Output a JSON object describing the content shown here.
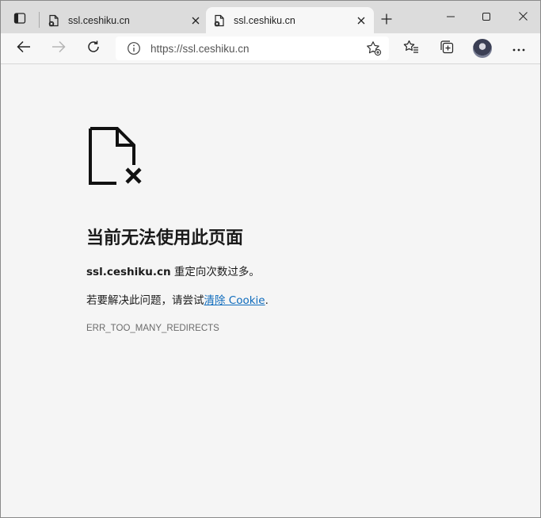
{
  "tabs": [
    {
      "title": "ssl.ceshiku.cn",
      "active": false
    },
    {
      "title": "ssl.ceshiku.cn",
      "active": true
    }
  ],
  "addressbar": {
    "url": "https://ssl.ceshiku.cn"
  },
  "error": {
    "title": "当前无法使用此页面",
    "host": "ssl.ceshiku.cn",
    "message": " 重定向次数过多。",
    "hint_prefix": "若要解决此问题，请尝试",
    "hint_link": "清除 Cookie",
    "hint_suffix": ".",
    "code": "ERR_TOO_MANY_REDIRECTS"
  },
  "icons": {
    "tab_actions": "tab-actions-icon",
    "page_error": "broken-page-icon",
    "back": "back-arrow-icon",
    "forward": "forward-arrow-icon",
    "refresh": "refresh-icon",
    "info": "info-icon",
    "add_favorite": "add-favorite-icon",
    "favorites": "favorites-icon",
    "collections": "collections-icon",
    "more": "more-icon",
    "new_tab": "plus-icon",
    "close_tab": "close-icon"
  },
  "colors": {
    "link": "#0f6cbd",
    "tabstrip": "#dcdcdc",
    "page_bg": "#f5f5f5"
  }
}
